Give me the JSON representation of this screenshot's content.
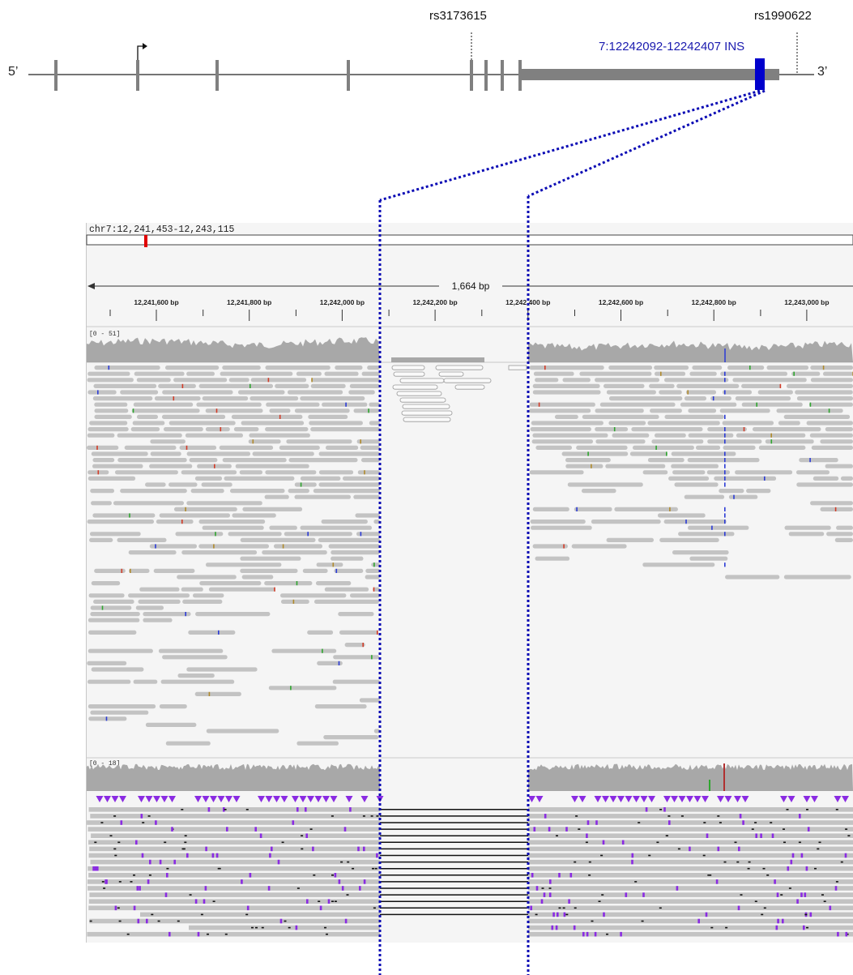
{
  "gene_diagram": {
    "five_prime_label": "5’",
    "three_prime_label": "3’",
    "snp_left": "rs3173615",
    "snp_right": "rs1990622",
    "insertion_label": "7:12242092-12242407 INS"
  },
  "igv": {
    "locus": "chr7:12,241,453-12,243,115",
    "span_label": "1,664 bp",
    "ruler_ticks": [
      "12,241,600 bp",
      "12,241,800 bp",
      "12,242,000 bp",
      "12,242,200 bp",
      "12,242,400 bp",
      "12,242,600 bp",
      "12,242,800 bp",
      "12,243,000 bp"
    ],
    "track1_range": "[0 - 51]",
    "track2_range": "[0 - 18]"
  },
  "colors": {
    "exon": "#7f7f7f",
    "insertion": "#0000cc",
    "zoom_lines": "#0000b4",
    "read": "#c3c3c3",
    "coverage": "#a8a8a8",
    "insertion_mark": "#8a2be2",
    "snv_blue": "#2b3bd6",
    "snv_red": "#d23c28",
    "snv_green": "#2fa52f"
  }
}
